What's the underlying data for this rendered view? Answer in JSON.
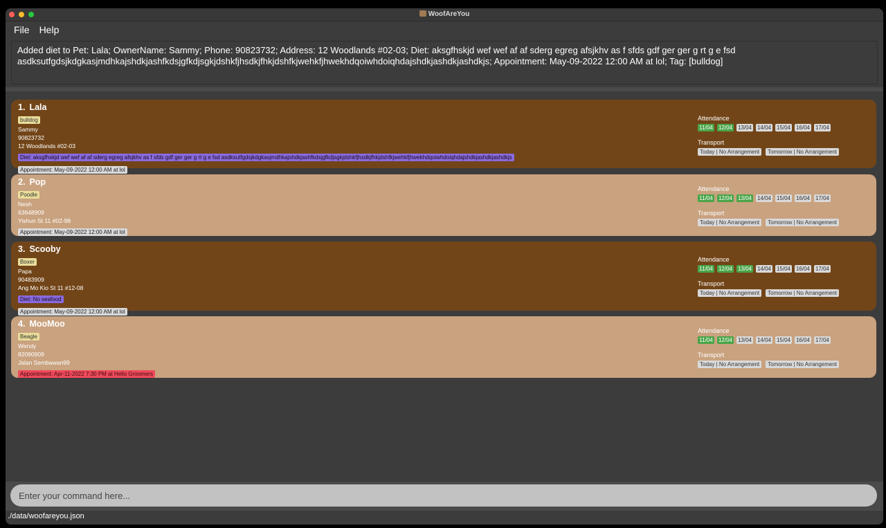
{
  "window": {
    "title": "WoofAreYou"
  },
  "menu": {
    "file": "File",
    "help": "Help"
  },
  "result": {
    "text": "Added diet to Pet: Lala; OwnerName: Sammy; Phone: 90823732; Address: 12 Woodlands #02-03; Diet: aksgfhskjd wef wef af af sderg egreg afsjkhv as f sfds gdf ger ger g rt g e fsd asdksutfgdsjkdgkasjmdhkajshdkjashfkdsjgfkdjsgkjdshkfjhsdkjfhkjdshfkjwehkfjhwekhdqoiwhdoiqhdajshdkjashdkjashdkjs; Appointment: May-09-2022 12:00 AM at lol; Tag: [bulldog]"
  },
  "labels": {
    "attendance": "Attendance",
    "transport": "Transport"
  },
  "pets": [
    {
      "index": "1.",
      "name": "Lala",
      "tag": "bulldog",
      "owner": "Sammy",
      "phone": "90823732",
      "address": "12 Woodlands #02-03",
      "diet": "Diet: aksgfhskjd wef wef af af sderg egreg afsjkhv as f sfds gdf ger ger g rt g e fsd asdksutfgdsjkdgkasjmdhkajshdkjashfkdsjgfkdjsgkjdshkfjhsdkjfhkjdshfkjwehkfjhwekhdqoiwhdoiqhdajshdkjashdkjashdkjs",
      "appointment": "Appointment: May-09-2022 12:00 AM at lol",
      "days": [
        "11/04",
        "12/04",
        "13/04",
        "14/04",
        "15/04",
        "16/04",
        "17/04"
      ],
      "transport_today": "Today | No Arrangement",
      "transport_tomorrow": "Tomorrow | No Arrangement"
    },
    {
      "index": "2.",
      "name": "Pop",
      "tag": "Poodle",
      "owner": "Nesh",
      "phone": "63648909",
      "address": "Yishun St 11 #02-98",
      "appointment": "Appointment: May-09-2022 12:00 AM at lol",
      "days": [
        "11/04",
        "12/04",
        "13/04",
        "14/04",
        "15/04",
        "16/04",
        "17/04"
      ],
      "transport_today": "Today | No Arrangement",
      "transport_tomorrow": "Tomorrow | No Arrangement"
    },
    {
      "index": "3.",
      "name": "Scooby",
      "tag": "Boxer",
      "owner": "Papa",
      "phone": "90483909",
      "address": "Ang Mo Kio St 11 #12-08",
      "diet": "Diet: No seafood",
      "appointment": "Appointment: May-09-2022 12:00 AM at lol",
      "days": [
        "11/04",
        "12/04",
        "13/04",
        "14/04",
        "15/04",
        "16/04",
        "17/04"
      ],
      "transport_today": "Today | No Arrangement",
      "transport_tomorrow": "Tomorrow | No Arrangement"
    },
    {
      "index": "4.",
      "name": "MooMoo",
      "tag": "Beagle",
      "owner": "Wendy",
      "phone": "82090909",
      "address": "Jalan Sembawan99",
      "appointment": "Appointment: Apr-11-2022 7:30 PM at Hello Groomers",
      "days": [
        "11/04",
        "12/04",
        "13/04",
        "14/04",
        "15/04",
        "16/04",
        "17/04"
      ],
      "transport_today": "Today | No Arrangement",
      "transport_tomorrow": "Tomorrow | No Arrangement"
    }
  ],
  "command": {
    "placeholder": "Enter your command here..."
  },
  "status": {
    "path": "./data/woofareyou.json"
  }
}
